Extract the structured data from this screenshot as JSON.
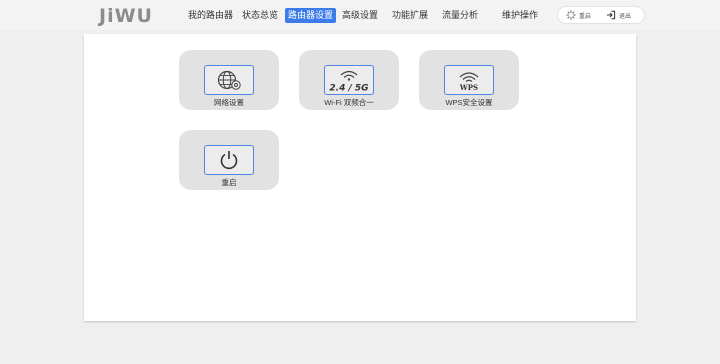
{
  "brand": {
    "logo": "JiWU"
  },
  "nav": {
    "items": [
      {
        "label": "我的路由器"
      },
      {
        "label": "状态总览"
      },
      {
        "label": "路由器设置"
      },
      {
        "label": "高级设置"
      },
      {
        "label": "功能扩展"
      },
      {
        "label": "流量分析"
      },
      {
        "label": "维护操作"
      }
    ],
    "active_index": 2
  },
  "actions": {
    "reboot_label": "重启",
    "logout_label": "退出"
  },
  "tiles": [
    {
      "label": "网络设置",
      "icon": "globe-settings-icon"
    },
    {
      "label": "Wi-Fi 双频合一",
      "icon": "wifi-dual-band-icon",
      "badge": "2.4 / 5G"
    },
    {
      "label": "WPS安全设置",
      "icon": "wps-icon",
      "badge": "WPS"
    },
    {
      "label": "重启",
      "icon": "power-icon"
    }
  ],
  "colors": {
    "accent": "#3b7bea",
    "tile_bg": "#e2e2e2",
    "page_bg": "#efefef"
  }
}
